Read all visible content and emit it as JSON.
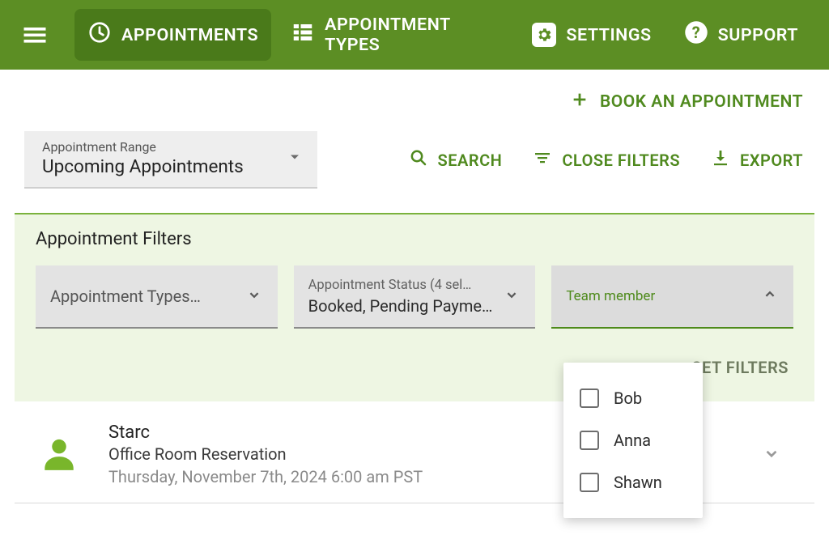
{
  "nav": {
    "appointments": "APPOINTMENTS",
    "appointment_types": "APPOINTMENT TYPES",
    "settings": "SETTINGS",
    "support": "SUPPORT"
  },
  "book_button": "BOOK AN APPOINTMENT",
  "range": {
    "label": "Appointment Range",
    "value": "Upcoming Appointments"
  },
  "actions": {
    "search": "SEARCH",
    "close_filters": "CLOSE FILTERS",
    "export": "EXPORT"
  },
  "filters": {
    "title": "Appointment Filters",
    "type_label": "Appointment Types…",
    "status_label": "Appointment Status (4 sel…",
    "status_value": "Booked, Pending Payme…",
    "team_label": "Team member",
    "reset": "SET FILTERS",
    "team_options": [
      {
        "label": "Bob"
      },
      {
        "label": "Anna"
      },
      {
        "label": "Shawn"
      }
    ]
  },
  "appointments": [
    {
      "name": "Starc",
      "type": "Office Room Reservation",
      "date": "Thursday, November 7th, 2024 6:00 am PST"
    }
  ]
}
